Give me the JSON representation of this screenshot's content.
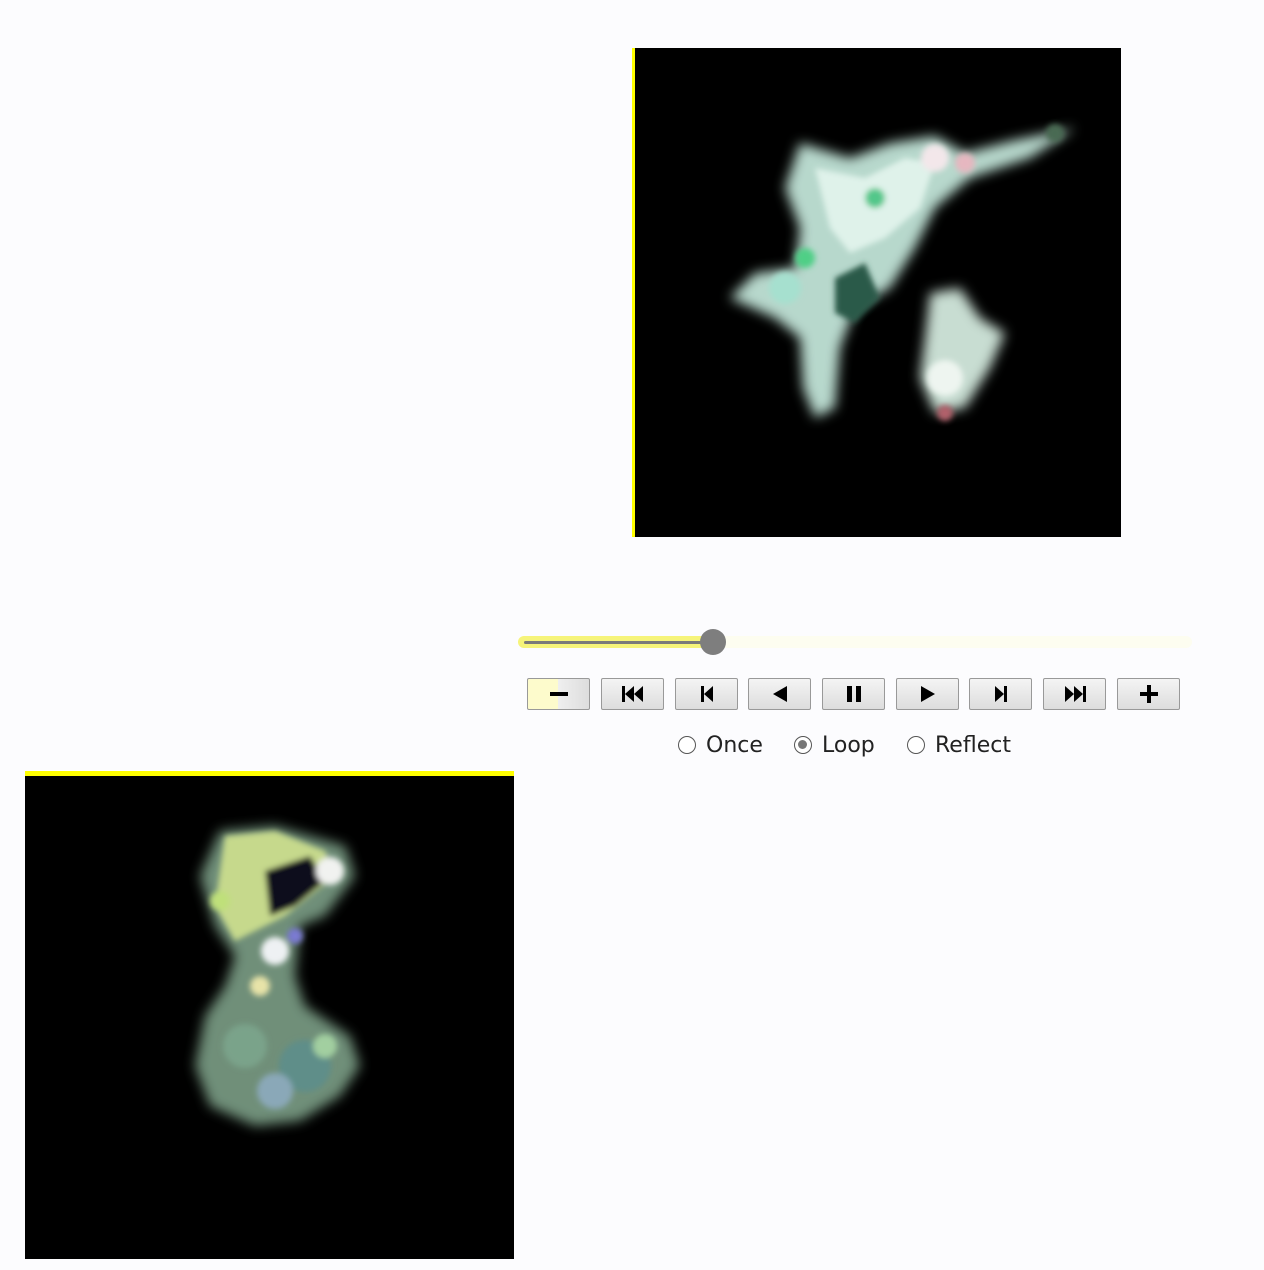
{
  "animation": {
    "frames": [
      {
        "name": "frame-top",
        "description_icon": "image-frame"
      },
      {
        "name": "frame-bottom",
        "description_icon": "image-frame"
      }
    ],
    "slider_fraction": 0.29,
    "buttons": [
      {
        "name": "decrease-speed-button",
        "icon": "minus-icon"
      },
      {
        "name": "first-frame-button",
        "icon": "skip-to-start-icon"
      },
      {
        "name": "previous-frame-button",
        "icon": "step-back-icon"
      },
      {
        "name": "play-reverse-button",
        "icon": "play-reverse-icon"
      },
      {
        "name": "pause-button",
        "icon": "pause-icon"
      },
      {
        "name": "play-button",
        "icon": "play-icon"
      },
      {
        "name": "next-frame-button",
        "icon": "step-forward-icon"
      },
      {
        "name": "last-frame-button",
        "icon": "skip-to-end-icon"
      },
      {
        "name": "increase-speed-button",
        "icon": "plus-icon"
      }
    ],
    "modes": {
      "once_label": "Once",
      "loop_label": "Loop",
      "reflect_label": "Reflect",
      "selected": "Loop"
    }
  },
  "colors": {
    "accent": "#ffff00",
    "slider_fill": "#f6f47a",
    "thumb": "#7e7e7e"
  }
}
